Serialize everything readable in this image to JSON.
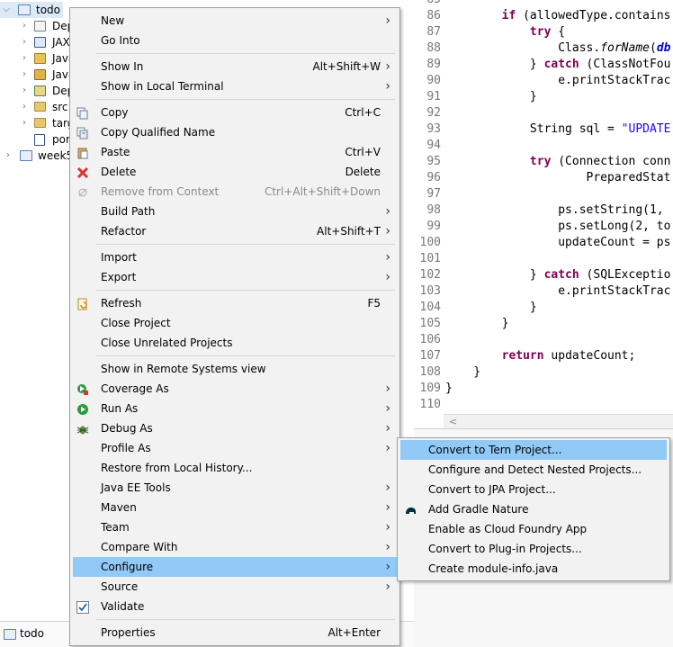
{
  "explorer": {
    "rows": [
      {
        "label": "todo",
        "icon": "project-icon"
      },
      {
        "label": "Dep",
        "icon": "deployment-descriptor-icon"
      },
      {
        "label": "JAX",
        "icon": "jax-ws-icon"
      },
      {
        "label": "Java",
        "icon": "java-resources-icon"
      },
      {
        "label": "Java",
        "icon": "javascript-resources-icon"
      },
      {
        "label": "Dep",
        "icon": "deployed-resources-icon"
      },
      {
        "label": "src",
        "icon": "folder-icon"
      },
      {
        "label": "targ",
        "icon": "folder-icon"
      },
      {
        "label": "pom",
        "icon": "maven-pom-icon"
      },
      {
        "label": "week5",
        "icon": "project-icon"
      }
    ],
    "status_label": "todo"
  },
  "editor": {
    "lines": [
      {
        "n": "85",
        "code": ""
      },
      {
        "n": "86",
        "code": "        if (allowedType.contains"
      },
      {
        "n": "87",
        "code": "            try {"
      },
      {
        "n": "88",
        "code": "                Class.forName(db"
      },
      {
        "n": "89",
        "code": "            } catch (ClassNotFou"
      },
      {
        "n": "90",
        "code": "                e.printStackTrac"
      },
      {
        "n": "91",
        "code": "            }"
      },
      {
        "n": "92",
        "code": ""
      },
      {
        "n": "93",
        "code": "            String sql = \"UPDATE"
      },
      {
        "n": "94",
        "code": ""
      },
      {
        "n": "95",
        "code": "            try (Connection conn"
      },
      {
        "n": "96",
        "code": "                    PreparedStat"
      },
      {
        "n": "97",
        "code": ""
      },
      {
        "n": "98",
        "code": "                ps.setString(1,"
      },
      {
        "n": "99",
        "code": "                ps.setLong(2, to"
      },
      {
        "n": "100",
        "code": "                updateCount = ps"
      },
      {
        "n": "101",
        "code": ""
      },
      {
        "n": "102",
        "code": "            } catch (SQLExceptio"
      },
      {
        "n": "103",
        "code": "                e.printStackTrac"
      },
      {
        "n": "104",
        "code": "            }"
      },
      {
        "n": "105",
        "code": "        }"
      },
      {
        "n": "106",
        "code": ""
      },
      {
        "n": "107",
        "code": "        return updateCount;"
      },
      {
        "n": "108",
        "code": "    }"
      },
      {
        "n": "109",
        "code": "}"
      },
      {
        "n": "110",
        "code": ""
      }
    ],
    "scroll_left_arrow": "<"
  },
  "context_menu": {
    "items": [
      {
        "label": "New",
        "submenu": true
      },
      {
        "label": "Go Into"
      },
      {
        "separator": true
      },
      {
        "label": "Show In",
        "shortcut": "Alt+Shift+W",
        "submenu": true
      },
      {
        "label": "Show in Local Terminal",
        "submenu": true
      },
      {
        "separator": true
      },
      {
        "label": "Copy",
        "shortcut": "Ctrl+C",
        "icon": "copy-icon"
      },
      {
        "label": "Copy Qualified Name",
        "icon": "copy-qualified-icon"
      },
      {
        "label": "Paste",
        "shortcut": "Ctrl+V",
        "icon": "paste-icon"
      },
      {
        "label": "Delete",
        "shortcut": "Delete",
        "icon": "delete-icon"
      },
      {
        "label": "Remove from Context",
        "shortcut": "Ctrl+Alt+Shift+Down",
        "icon": "remove-context-icon",
        "disabled": true
      },
      {
        "label": "Build Path",
        "submenu": true
      },
      {
        "label": "Refactor",
        "shortcut": "Alt+Shift+T",
        "submenu": true
      },
      {
        "separator": true
      },
      {
        "label": "Import",
        "submenu": true
      },
      {
        "label": "Export",
        "submenu": true
      },
      {
        "separator": true
      },
      {
        "label": "Refresh",
        "shortcut": "F5",
        "icon": "refresh-icon"
      },
      {
        "label": "Close Project"
      },
      {
        "label": "Close Unrelated Projects"
      },
      {
        "separator": true
      },
      {
        "label": "Show in Remote Systems view"
      },
      {
        "label": "Coverage As",
        "submenu": true,
        "icon": "coverage-icon"
      },
      {
        "label": "Run As",
        "submenu": true,
        "icon": "run-icon"
      },
      {
        "label": "Debug As",
        "submenu": true,
        "icon": "debug-icon"
      },
      {
        "label": "Profile As",
        "submenu": true
      },
      {
        "label": "Restore from Local History..."
      },
      {
        "label": "Java EE Tools",
        "submenu": true
      },
      {
        "label": "Maven",
        "submenu": true
      },
      {
        "label": "Team",
        "submenu": true
      },
      {
        "label": "Compare With",
        "submenu": true
      },
      {
        "label": "Configure",
        "submenu": true,
        "highlighted": true
      },
      {
        "label": "Source",
        "submenu": true
      },
      {
        "label": "Validate",
        "icon": "validate-check-icon"
      },
      {
        "separator": true
      },
      {
        "label": "Properties",
        "shortcut": "Alt+Enter"
      }
    ]
  },
  "configure_submenu": {
    "items": [
      {
        "label": "Convert to Tern Project...",
        "highlighted": true
      },
      {
        "label": "Configure and Detect Nested Projects..."
      },
      {
        "label": "Convert to JPA Project..."
      },
      {
        "label": "Add Gradle Nature",
        "icon": "gradle-elephant-icon"
      },
      {
        "label": "Enable as Cloud Foundry App"
      },
      {
        "label": "Convert to Plug-in Projects..."
      },
      {
        "label": "Create module-info.java"
      }
    ]
  },
  "colors": {
    "highlight": "#91c9f7",
    "keyword": "#7f0055",
    "string": "#2a00ff"
  }
}
